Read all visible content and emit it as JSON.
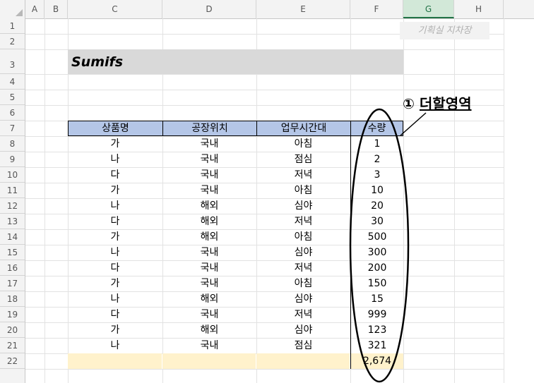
{
  "columns": [
    "A",
    "B",
    "C",
    "D",
    "E",
    "F",
    "G",
    "H"
  ],
  "selected_column": "G",
  "rows": [
    "1",
    "2",
    "3",
    "4",
    "5",
    "6",
    "7",
    "8",
    "9",
    "10",
    "11",
    "12",
    "13",
    "14",
    "15",
    "16",
    "17",
    "18",
    "19",
    "20",
    "21",
    "22"
  ],
  "badge": "기획실 지차장",
  "title": "Sumifs",
  "annotation": {
    "marker": "①",
    "text": "더할영역"
  },
  "table": {
    "headers": [
      "상품명",
      "공장위치",
      "업무시간대",
      "수량"
    ],
    "rows": [
      [
        "가",
        "국내",
        "아침",
        "1"
      ],
      [
        "나",
        "국내",
        "점심",
        "2"
      ],
      [
        "다",
        "국내",
        "저녁",
        "3"
      ],
      [
        "가",
        "국내",
        "아침",
        "10"
      ],
      [
        "나",
        "해외",
        "심야",
        "20"
      ],
      [
        "다",
        "해외",
        "저녁",
        "30"
      ],
      [
        "가",
        "해외",
        "아침",
        "500"
      ],
      [
        "나",
        "국내",
        "심야",
        "300"
      ],
      [
        "다",
        "국내",
        "저녁",
        "200"
      ],
      [
        "가",
        "국내",
        "아침",
        "150"
      ],
      [
        "나",
        "해외",
        "심야",
        "15"
      ],
      [
        "다",
        "국내",
        "저녁",
        "999"
      ],
      [
        "가",
        "해외",
        "심야",
        "123"
      ],
      [
        "나",
        "국내",
        "점심",
        "321"
      ]
    ],
    "total": "2,674"
  },
  "colors": {
    "header_fill": "#b4c6e7",
    "total_fill": "#fff2cc",
    "title_fill": "#d9d9d9",
    "selected_col": "#217346"
  }
}
